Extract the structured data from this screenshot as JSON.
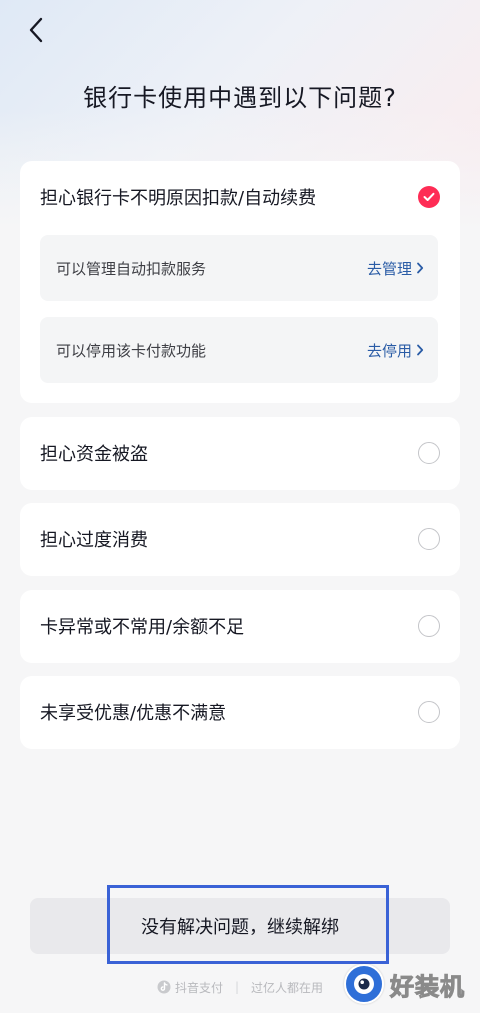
{
  "page": {
    "title": "银行卡使用中遇到以下问题?"
  },
  "options": [
    {
      "label": "担心银行卡不明原因扣款/自动续费",
      "checked": true,
      "sub_items": [
        {
          "label": "可以管理自动扣款服务",
          "action": "去管理"
        },
        {
          "label": "可以停用该卡付款功能",
          "action": "去停用"
        }
      ]
    },
    {
      "label": "担心资金被盗",
      "checked": false
    },
    {
      "label": "担心过度消费",
      "checked": false
    },
    {
      "label": "卡异常或不常用/余额不足",
      "checked": false
    },
    {
      "label": "未享受优惠/优惠不满意",
      "checked": false
    }
  ],
  "continue_button": {
    "label": "没有解决问题，继续解绑"
  },
  "footer": {
    "brand": "抖音支付",
    "tagline": "过亿人都在用"
  },
  "watermark": {
    "text": "好装机"
  },
  "colors": {
    "accent": "#fe2c55",
    "link": "#2a5ca6",
    "highlight": "#3a62d6"
  }
}
